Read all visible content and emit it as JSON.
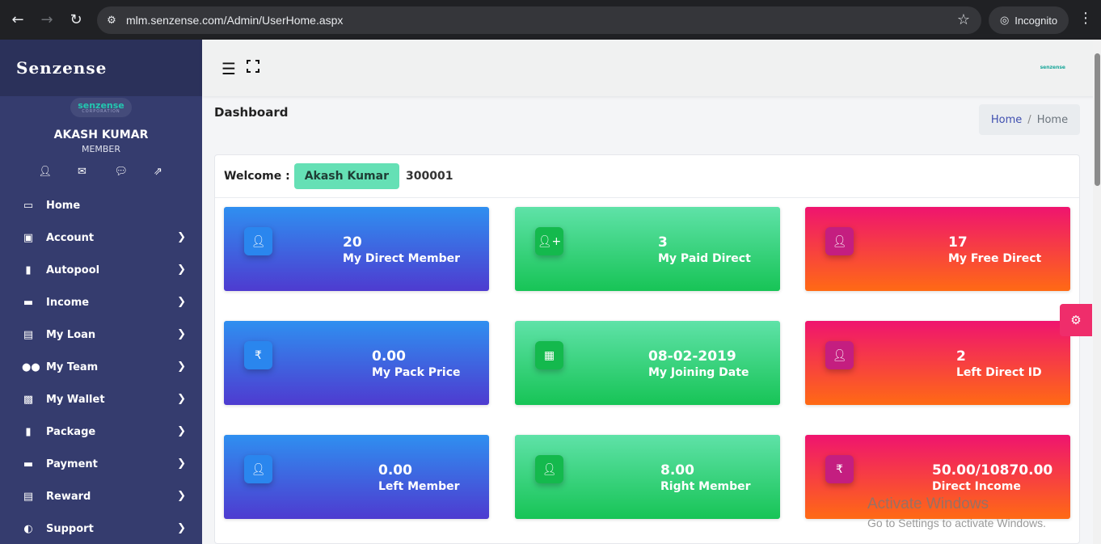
{
  "browser": {
    "url": "mlm.senzense.com/Admin/UserHome.aspx",
    "incognito_label": "Incognito"
  },
  "sidebar": {
    "brand": "Senzense",
    "logo_text": "senzense",
    "logo_subtext": "CORPORATION",
    "user_name": "AKASH KUMAR",
    "user_role": "MEMBER",
    "items": [
      {
        "label": "Home",
        "icon": "monitor-icon",
        "submenu": false
      },
      {
        "label": "Account",
        "icon": "book-icon",
        "submenu": true
      },
      {
        "label": "Autopool",
        "icon": "file-icon",
        "submenu": true
      },
      {
        "label": "Income",
        "icon": "credit-card-icon",
        "submenu": true
      },
      {
        "label": "My Loan",
        "icon": "id-card-icon",
        "submenu": true
      },
      {
        "label": "My Team",
        "icon": "users-icon",
        "submenu": true
      },
      {
        "label": "My Wallet",
        "icon": "wallet-icon",
        "submenu": true
      },
      {
        "label": "Package",
        "icon": "file-icon",
        "submenu": true
      },
      {
        "label": "Payment",
        "icon": "credit-card-icon",
        "submenu": true
      },
      {
        "label": "Reward",
        "icon": "id-card-icon",
        "submenu": true
      },
      {
        "label": "Support",
        "icon": "adjust-icon",
        "submenu": true
      }
    ]
  },
  "topbar": {
    "logo_text": "senzense"
  },
  "page": {
    "title": "Dashboard",
    "breadcrumb": {
      "home": "Home",
      "separator": "/",
      "current": "Home"
    }
  },
  "welcome": {
    "label": "Welcome :",
    "name": "Akash Kumar",
    "user_id": "300001"
  },
  "stats": [
    {
      "value": "20",
      "label": "My Direct Member",
      "icon": "user-icon",
      "color": "blue"
    },
    {
      "value": "3",
      "label": "My Paid Direct",
      "icon": "user-plus-icon",
      "color": "green"
    },
    {
      "value": "17",
      "label": "My Free Direct",
      "icon": "user-icon",
      "color": "pink"
    },
    {
      "value": "0.00",
      "label": "My Pack Price",
      "icon": "rupee-icon",
      "color": "blue"
    },
    {
      "value": "08-02-2019",
      "label": "My Joining Date",
      "icon": "calendar-icon",
      "color": "green"
    },
    {
      "value": "2",
      "label": "Left Direct ID",
      "icon": "user-icon",
      "color": "pink"
    },
    {
      "value": "0.00",
      "label": "Left Member",
      "icon": "user-icon",
      "color": "blue"
    },
    {
      "value": "8.00",
      "label": "Right Member",
      "icon": "user-icon",
      "color": "green"
    },
    {
      "value": "50.00/10870.00",
      "label": "Direct Income",
      "icon": "rupee-icon",
      "color": "pink"
    }
  ],
  "watermark": {
    "line1": "Activate Windows",
    "line2": "Go to Settings to activate Windows."
  }
}
